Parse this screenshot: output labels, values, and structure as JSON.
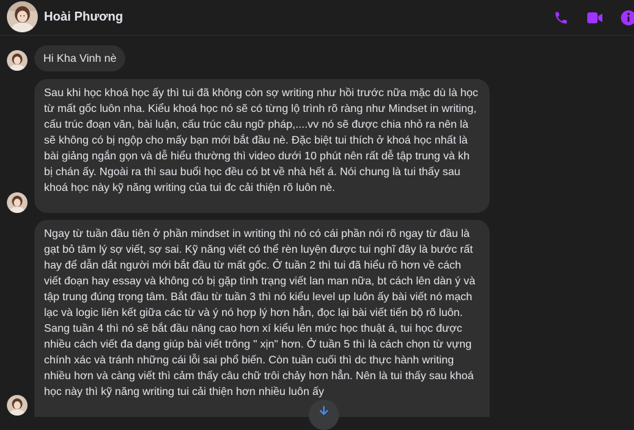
{
  "header": {
    "contact_name": "Hoài Phương",
    "accent_color": "#a033ff",
    "icons": [
      "phone-icon",
      "video-icon",
      "info-icon"
    ]
  },
  "messages": [
    {
      "text": "Hi Kha Vinh nè"
    },
    {
      "text": "Sau khi học khoá học ấy thì tui đã không còn sợ writing như hồi trước nữa mặc dù là học từ mất gốc luôn nha. Kiểu khoá học nó sẽ có từng lộ trình rõ ràng như Mindset in writing, cấu trúc đoạn văn, bài luận, cấu trúc câu ngữ pháp,....vv nó sẽ được chia nhỏ ra nên là sẽ không có bị ngộp cho mấy bạn mới bắt đầu nè. Đặc biệt tui thích ở khoá học nhất là bài giảng ngắn gọn và dễ hiểu thường thì video dưới 10 phút nên rất dễ tập trung và kh bị chán ấy. Ngoài ra thì sau buổi học đều có bt về nhà hết á. Nói chung là tui thấy sau khoá học này kỹ năng writing của tui đc cải thiện rõ luôn nè."
    },
    {
      "text": "Ngay từ tuần đầu tiên ở phần mindset in writing thì nó có cái phần nói rõ ngay từ đầu là gạt bỏ tâm lý sợ viết, sợ sai. Kỹ năng viết có thể rèn luyện được tui nghĩ đây là bước rất hay để dẫn dắt người mới bắt đầu từ mất gốc. Ở tuần 2 thì tui đã hiểu rõ hơn về cách viết đoạn hay essay và không có bị gặp tình trạng viết lan man nữa, bt cách lên dàn ý và tập trung đúng trọng tâm. Bắt đầu từ tuần 3 thì nó kiểu level up luôn ấy bài viết nó mạch lạc và logic liên kết giữa các từ và ý nó hợp lý hơn hẳn, đọc lại bài viết tiến bộ rõ luôn. Sang tuần 4 thì nó sẽ bắt đầu nâng cao hơn xí kiểu lên mức học thuật á, tui học được nhiều cách viết đa dạng giúp bài viết trông \" xịn\" hơn. Ở tuần 5 thì là cách chọn từ vựng chính xác và tránh những cái lỗi sai phổ biến. Còn tuần cuối thì dc thực hành writing nhiều hơn và càng viết thì cảm thấy câu chữ trôi chảy hơn hẳn. Nên là tui thấy sau khoá học này thì kỹ năng writing tui cải thiện hơn nhiều luôn ấy"
    }
  ]
}
